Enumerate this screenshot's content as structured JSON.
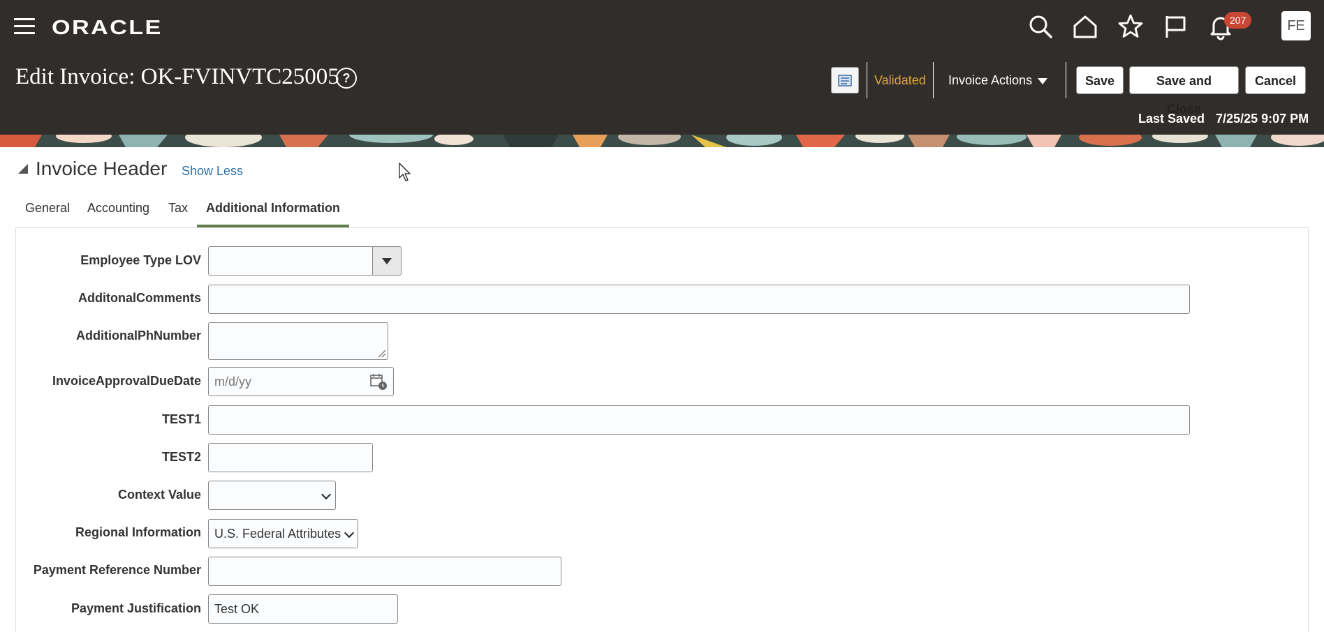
{
  "header": {
    "brand": "ORACLE",
    "notification_count": "207",
    "user_initials": "FE",
    "page_title": "Edit Invoice: OK-FVINVTC25005",
    "help_glyph": "?",
    "status": "Validated",
    "invoice_actions_label": "Invoice Actions",
    "save_label": "Save",
    "save_close_label": "Save and Close",
    "cancel_label": "Cancel",
    "last_saved_label": "Last Saved",
    "last_saved_value": "7/25/25 9:07 PM",
    "icons": [
      "menu-icon",
      "search-icon",
      "home-icon",
      "favorites-star-icon",
      "flag-icon",
      "bell-icon"
    ]
  },
  "section": {
    "title": "Invoice Header",
    "show_less": "Show Less"
  },
  "tabs": [
    {
      "label": "General"
    },
    {
      "label": "Accounting"
    },
    {
      "label": "Tax"
    },
    {
      "label": "Additional Information"
    }
  ],
  "active_tab": "Additional Information",
  "form": {
    "employee_type_lov": {
      "label": "Employee Type LOV",
      "value": ""
    },
    "additional_comments": {
      "label": "AdditonalComments",
      "value": ""
    },
    "additional_ph_number": {
      "label": "AdditionalPhNumber",
      "value": ""
    },
    "invoice_approval_due_date": {
      "label": "InvoiceApprovalDueDate",
      "value": "",
      "placeholder": "m/d/yy"
    },
    "test1": {
      "label": "TEST1",
      "value": ""
    },
    "test2": {
      "label": "TEST2",
      "value": ""
    },
    "context_value": {
      "label": "Context Value",
      "value": ""
    },
    "regional_information": {
      "label": "Regional Information",
      "value": "U.S. Federal Attributes"
    },
    "payment_reference_number": {
      "label": "Payment Reference Number",
      "value": ""
    },
    "payment_justification": {
      "label": "Payment Justification",
      "value": "Test OK"
    }
  },
  "colors": {
    "header_bg": "#312d2a",
    "validated": "#e0a53d",
    "badge": "#c74634",
    "link": "#2c6ea6",
    "tab_underline": "#5f7d4f"
  }
}
